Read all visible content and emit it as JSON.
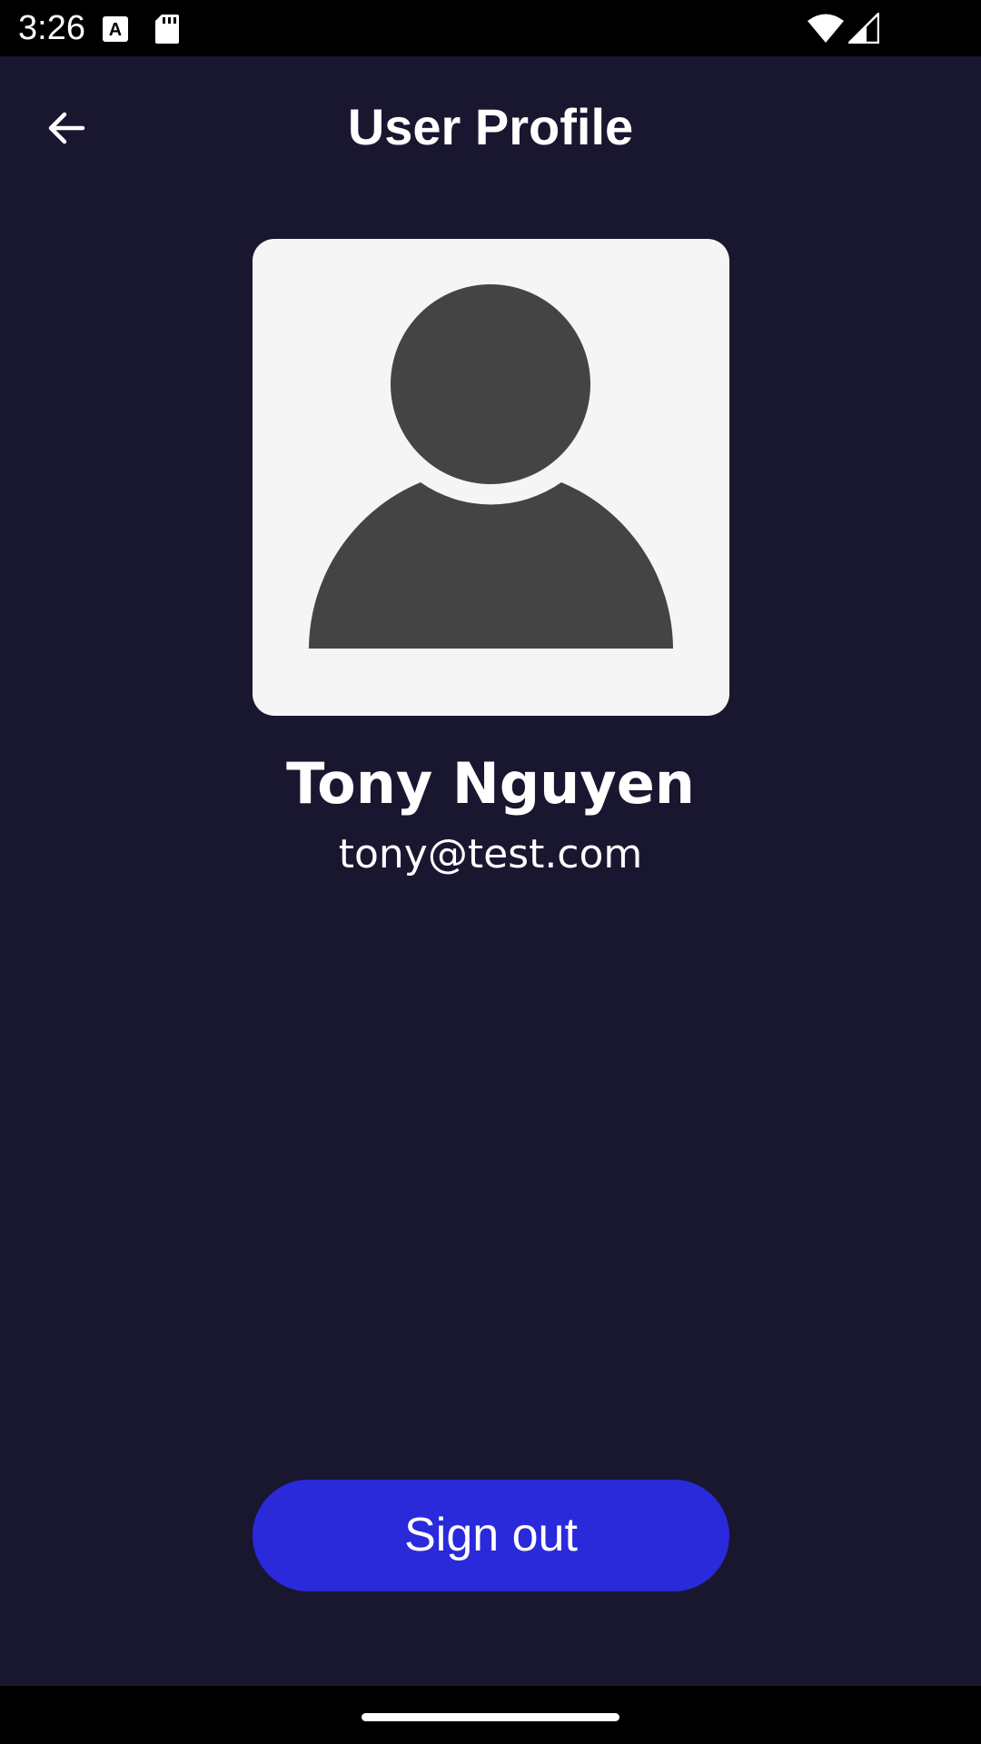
{
  "status_bar": {
    "time": "3:26",
    "icons": [
      "font-download-icon",
      "sd-card-icon",
      "wifi-icon",
      "cell-signal-icon"
    ]
  },
  "app_bar": {
    "title": "User Profile",
    "back_icon": "arrow-back-icon"
  },
  "profile": {
    "avatar_icon": "default-user-avatar-icon",
    "name": "Tony Nguyen",
    "email": "tony@test.com"
  },
  "actions": {
    "sign_out_label": "Sign out"
  },
  "colors": {
    "background": "#191730",
    "accent_button": "#2a2adb",
    "avatar_card": "#f5f5f5",
    "avatar_figure": "#444444",
    "system_bars": "#000000"
  }
}
